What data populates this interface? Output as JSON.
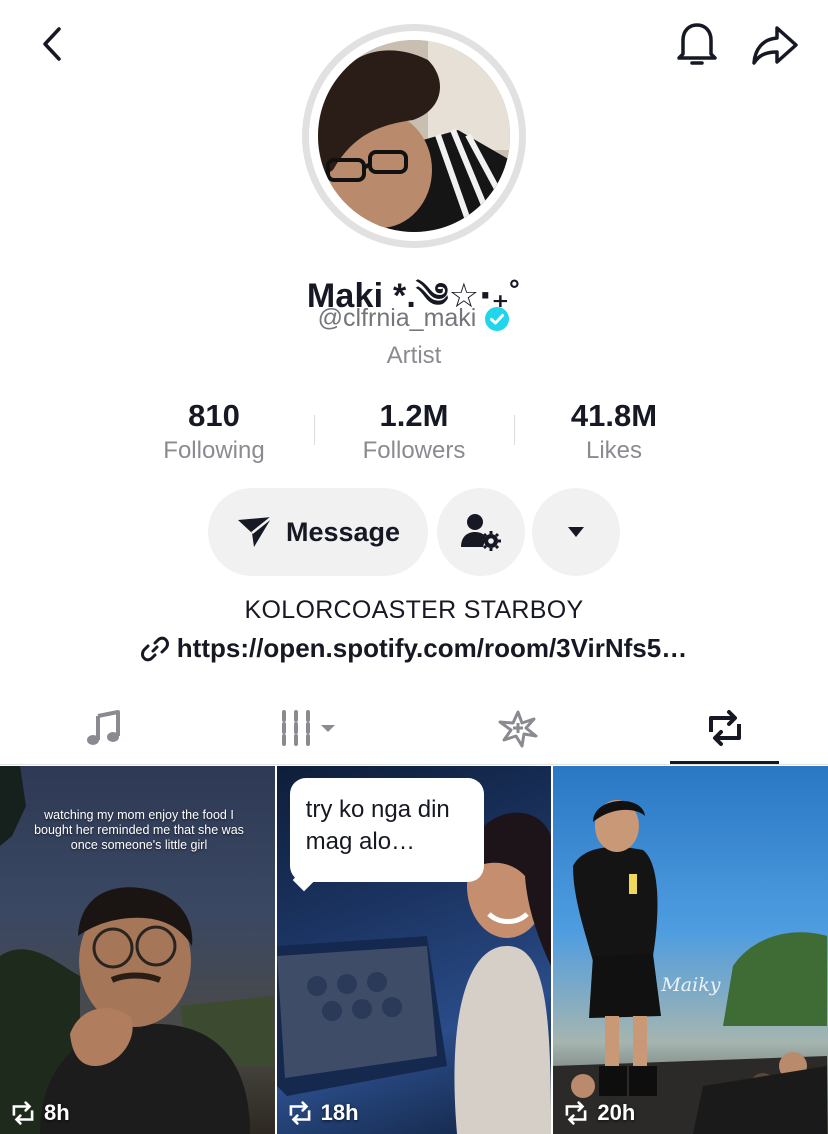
{
  "profile": {
    "display_name": "Maki *.༄☆‧₊˚",
    "handle": "@clfrnia_maki",
    "category": "Artist",
    "verified": true
  },
  "stats": [
    {
      "value": "810",
      "label": "Following"
    },
    {
      "value": "1.2M",
      "label": "Followers"
    },
    {
      "value": "41.8M",
      "label": "Likes"
    }
  ],
  "actions": {
    "message_label": "Message"
  },
  "bio": {
    "text": "KOLORCOASTER STARBOY",
    "link": "https://open.spotify.com/room/3VirNfs5…"
  },
  "tabs": [
    {
      "icon": "music-note-icon",
      "active": false
    },
    {
      "icon": "grid-filter-icon",
      "active": false
    },
    {
      "icon": "sparkle-icon",
      "active": false
    },
    {
      "icon": "repost-icon",
      "active": true
    }
  ],
  "videos": [
    {
      "caption": "watching my mom enjoy the food I bought her reminded me that she was once someone's little girl",
      "time": "8h"
    },
    {
      "caption": "try ko nga din mag alo…",
      "time": "18h"
    },
    {
      "watermark": "Maiky",
      "time": "20h"
    }
  ],
  "colors": {
    "text": "#161823",
    "secondary": "#8a8b91",
    "verified": "#20d5ec",
    "pill_bg": "#f1f1f2"
  }
}
